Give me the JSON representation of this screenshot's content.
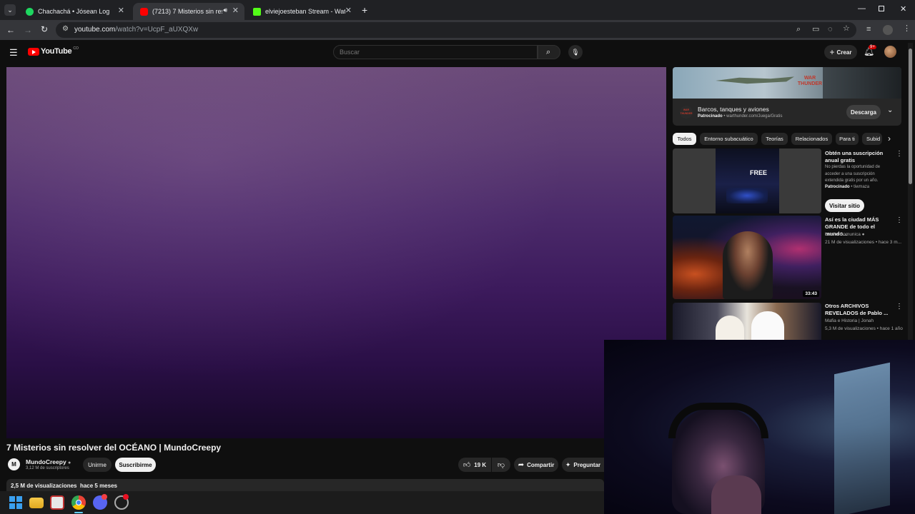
{
  "browser": {
    "tabs": [
      {
        "title": "Chachachá • Jósean Log",
        "active": false
      },
      {
        "title": "(7213) 7 Misterios sin resolv",
        "active": true
      },
      {
        "title": "elviejoesteban Stream - Watch",
        "active": false
      }
    ],
    "url_domain": "youtube.com",
    "url_path": "/watch?v=UcpF_aUXQXw"
  },
  "youtube": {
    "logo": "YouTube",
    "logo_country": "CO",
    "search_placeholder": "Buscar",
    "create_label": "Crear",
    "notif_badge": "9+"
  },
  "video": {
    "title": "7 Misterios sin resolver del OCÉANO | MundoCreepy",
    "channel": "MundoCreepy",
    "subscribers": "3,12 M de suscriptores",
    "join_label": "Unirme",
    "subscribe_label": "Suscribirme",
    "likes": "19 K",
    "share_label": "Compartir",
    "ask_label": "Preguntar",
    "views": "2,5 M de visualizaciones",
    "age": "hace 5 meses"
  },
  "ad": {
    "title": "Barcos, tanques y aviones",
    "sponsored": "Patrocinado",
    "domain": "warthunder.com/Juega/Gratis",
    "button": "Descarga",
    "banner_text": "WAR THUNDER",
    "logo_text": "WAR THUNDER"
  },
  "chips": [
    "Todos",
    "Entorno subacuático",
    "Teorías",
    "Relacionados",
    "Para ti",
    "Subid"
  ],
  "recommendations": [
    {
      "title": "Obtén una suscripción anual gratis",
      "desc": "No pierdas la oportunidad de acceder a una suscripción extendida gratis por un año.",
      "sponsored": "Patrocinado",
      "advertiser": "tiwmaza",
      "cta": "Visitar sitio",
      "thumb_text": "FREE"
    },
    {
      "title": "Así es la ciudad MÁS GRANDE de todo el mundo...",
      "channel": "Luisito Comunica",
      "meta": "21 M de visualizaciones • hace 3 m...",
      "duration": "33:43"
    },
    {
      "title": "Otros ARCHIVOS REVELADOS de Pablo ...",
      "channel": "Mafia e Historia | Jonah",
      "meta": "5,3 M de visualizaciones • hace 1 año"
    }
  ],
  "colors": {
    "bg": "#0f0f0f",
    "chip_bg": "#272727",
    "youtube_red": "#ff0000",
    "video_purple": "#4b2a6a"
  }
}
